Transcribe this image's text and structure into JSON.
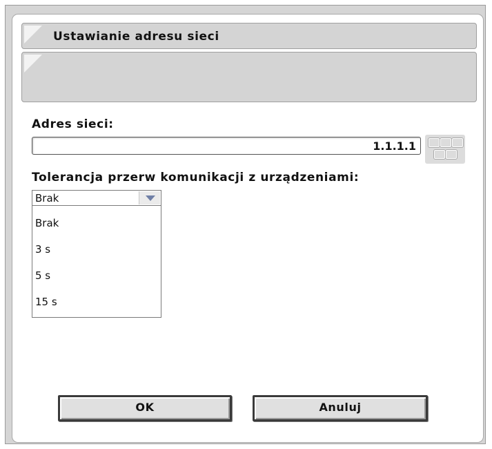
{
  "dialog": {
    "title": "Ustawianie adresu sieci"
  },
  "address": {
    "label": "Adres sieci:",
    "value": "1.1.1.1",
    "keypad_icon": "keypad-icon"
  },
  "tolerance": {
    "label": "Tolerancja przerw komunikacji z urządzeniami:",
    "selected": "Brak",
    "options": [
      "Brak",
      "3 s",
      "5 s",
      "15 s"
    ]
  },
  "buttons": {
    "ok_label": "OK",
    "cancel_label": "Anuluj"
  }
}
